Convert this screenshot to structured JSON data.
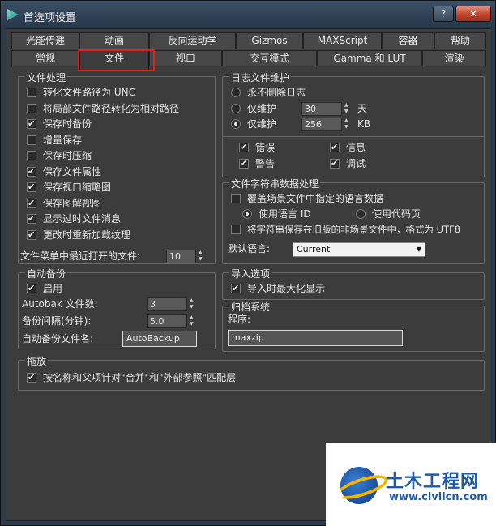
{
  "window": {
    "title": "首选项设置",
    "help_label": "?",
    "close_label": "✕"
  },
  "tabs_row1": [
    "光能传递",
    "动画",
    "反向运动学",
    "Gizmos",
    "MAXScript",
    "容器",
    "帮助"
  ],
  "tabs_row2": [
    "常规",
    "文件",
    "视口",
    "交互模式",
    "Gamma 和 LUT",
    "渲染"
  ],
  "active_tab": "文件",
  "file_handling": {
    "title": "文件处理",
    "options": [
      {
        "label": "转化文件路径为 UNC",
        "checked": false
      },
      {
        "label": "将局部文件路径转化为相对路径",
        "checked": false
      },
      {
        "label": "保存时备份",
        "checked": true
      },
      {
        "label": "增量保存",
        "checked": false
      },
      {
        "label": "保存时压缩",
        "checked": false
      },
      {
        "label": "保存文件属性",
        "checked": true
      },
      {
        "label": "保存视口缩略图",
        "checked": true
      },
      {
        "label": "保存图解视图",
        "checked": true
      },
      {
        "label": "显示过时文件消息",
        "checked": true
      },
      {
        "label": "更改时重新加载纹理",
        "checked": true
      }
    ],
    "recent_files_label": "文件菜单中最近打开的文件:",
    "recent_files_value": "10"
  },
  "log_maintenance": {
    "title": "日志文件维护",
    "never_delete_label": "永不删除日志",
    "keep_days_label": "仅维护",
    "keep_days_value": "30",
    "keep_days_unit": "天",
    "keep_kb_label": "仅维护",
    "keep_kb_value": "256",
    "keep_kb_unit": "KB",
    "selected": "kb",
    "types": [
      {
        "label": "错误",
        "checked": true
      },
      {
        "label": "信息",
        "checked": true
      },
      {
        "label": "警告",
        "checked": true
      },
      {
        "label": "调试",
        "checked": true
      }
    ]
  },
  "string_data": {
    "title": "文件字符串数据处理",
    "override_label": "覆盖场景文件中指定的语言数据",
    "override_checked": false,
    "use_lang_id_label": "使用语言 ID",
    "use_codepage_label": "使用代码页",
    "selected": "lang_id",
    "save_utf8_label": "将字符串保存在旧版的非场景文件中，格式为 UTF8",
    "save_utf8_checked": false,
    "default_lang_label": "默认语言:",
    "default_lang_value": "Current"
  },
  "auto_backup": {
    "title": "自动备份",
    "enable_label": "启用",
    "enable_checked": true,
    "count_label": "Autobak 文件数:",
    "count_value": "3",
    "interval_label": "备份间隔(分钟):",
    "interval_value": "5.0",
    "name_label": "自动备份文件名:",
    "name_value": "AutoBackup"
  },
  "import": {
    "title": "导入选项",
    "maximize_label": "导入时最大化显示",
    "maximize_checked": true
  },
  "archive": {
    "title": "归档系统",
    "program_label": "程序:",
    "program_value": "maxzip"
  },
  "drag_drop": {
    "title": "拖放",
    "match_label": "按名称和父项针对\"合并\"和\"外部参照\"匹配层",
    "match_checked": true
  },
  "watermark": {
    "name": "土木工程网",
    "url": "www.civilcn.com"
  }
}
